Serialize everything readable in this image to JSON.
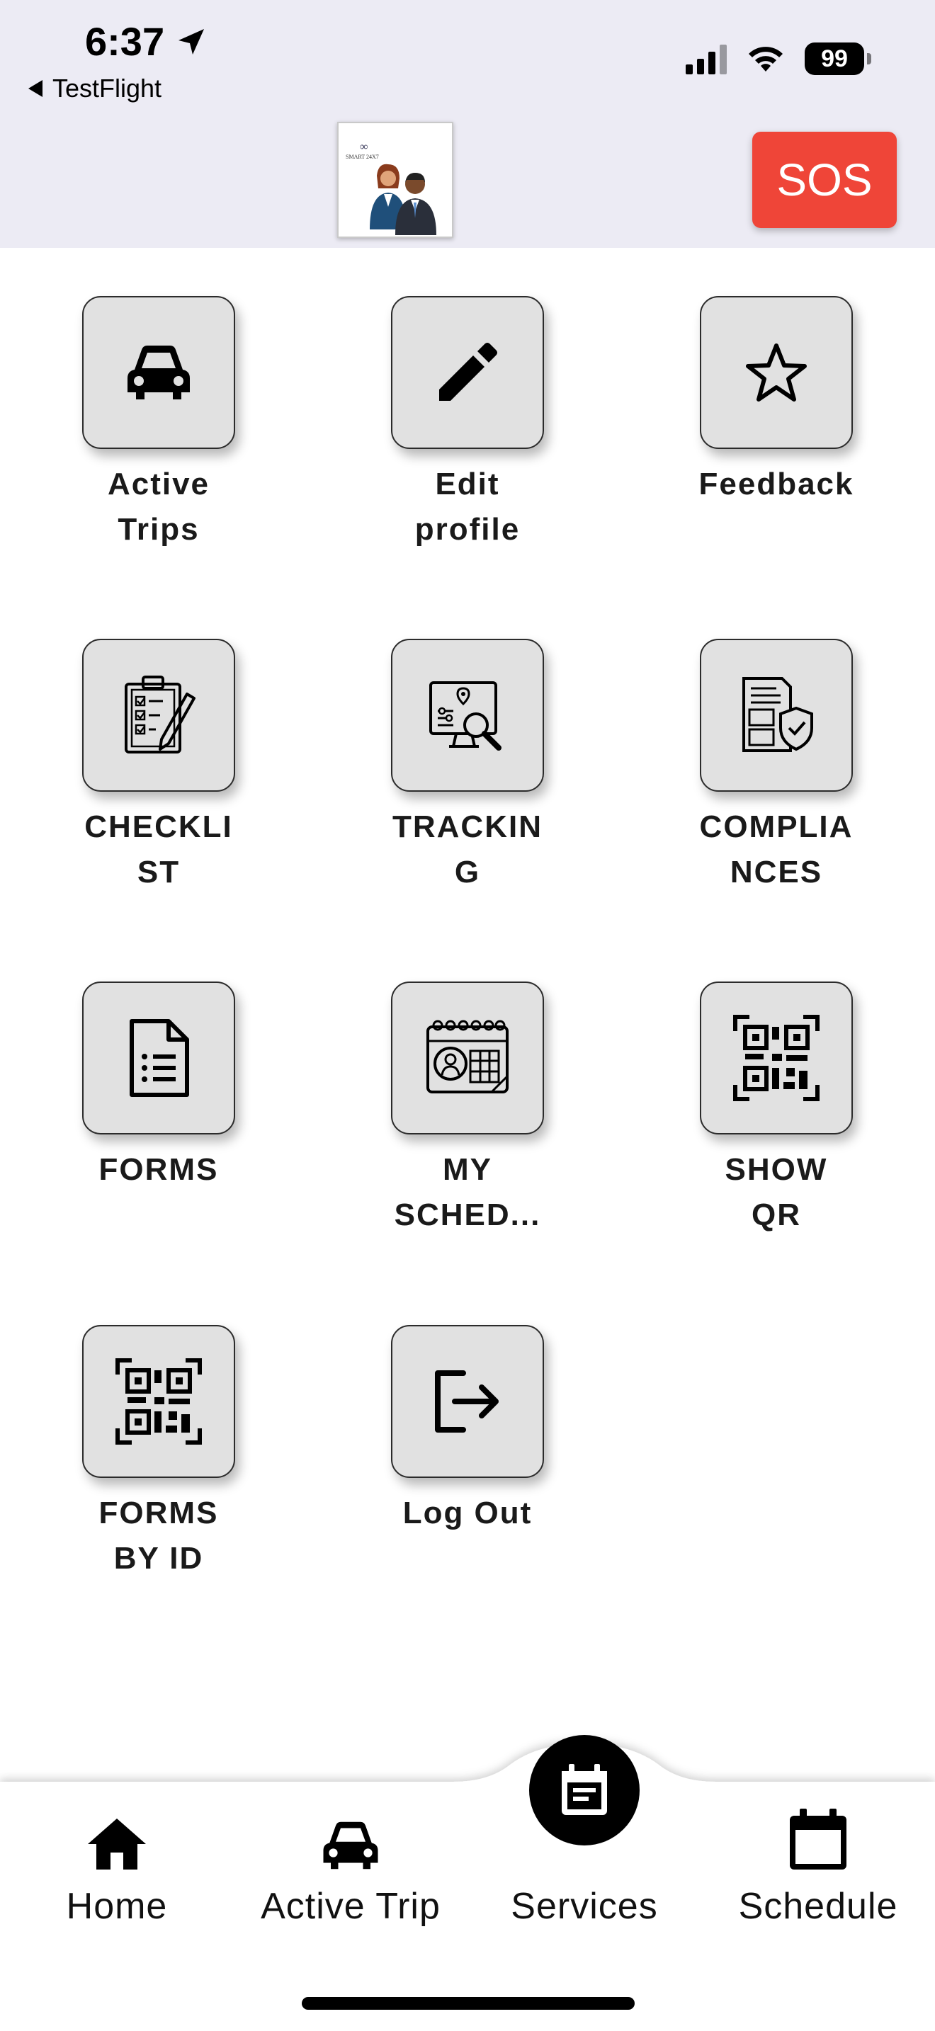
{
  "status_bar": {
    "time": "6:37",
    "back_app": "TestFlight",
    "battery": "99"
  },
  "header": {
    "logo_text": "SMART 24X7",
    "sos_label": "SOS"
  },
  "tiles": [
    {
      "line1": "Active",
      "line2": "Trips",
      "icon": "car-icon"
    },
    {
      "line1": "Edit",
      "line2": "profile",
      "icon": "pencil-icon"
    },
    {
      "line1": "Feedback",
      "line2": "",
      "icon": "star-icon"
    },
    {
      "line1": "CHECKLI",
      "line2": "ST",
      "icon": "clipboard-checklist-icon"
    },
    {
      "line1": "TRACKIN",
      "line2": "G",
      "icon": "tracking-monitor-icon"
    },
    {
      "line1": "COMPLIA",
      "line2": "NCES",
      "icon": "document-shield-icon"
    },
    {
      "line1": "FORMS",
      "line2": "",
      "icon": "document-list-icon"
    },
    {
      "line1": "MY",
      "line2": "SCHED...",
      "icon": "calendar-user-icon"
    },
    {
      "line1": "SHOW",
      "line2": "QR",
      "icon": "qr-code-icon"
    },
    {
      "line1": "FORMS",
      "line2": "BY ID",
      "icon": "qr-code-icon"
    },
    {
      "line1": "Log Out",
      "line2": "",
      "icon": "logout-icon"
    }
  ],
  "bottom_nav": [
    {
      "label": "Home",
      "icon": "home-icon"
    },
    {
      "label": "Active Trip",
      "icon": "car-icon"
    },
    {
      "label": "Services",
      "icon": "services-calendar-icon",
      "active": true
    },
    {
      "label": "Schedule",
      "icon": "calendar-icon"
    }
  ],
  "colors": {
    "header_bg": "#ecebf4",
    "sos_red": "#ef4538",
    "tile_bg": "#e1e1e1"
  }
}
